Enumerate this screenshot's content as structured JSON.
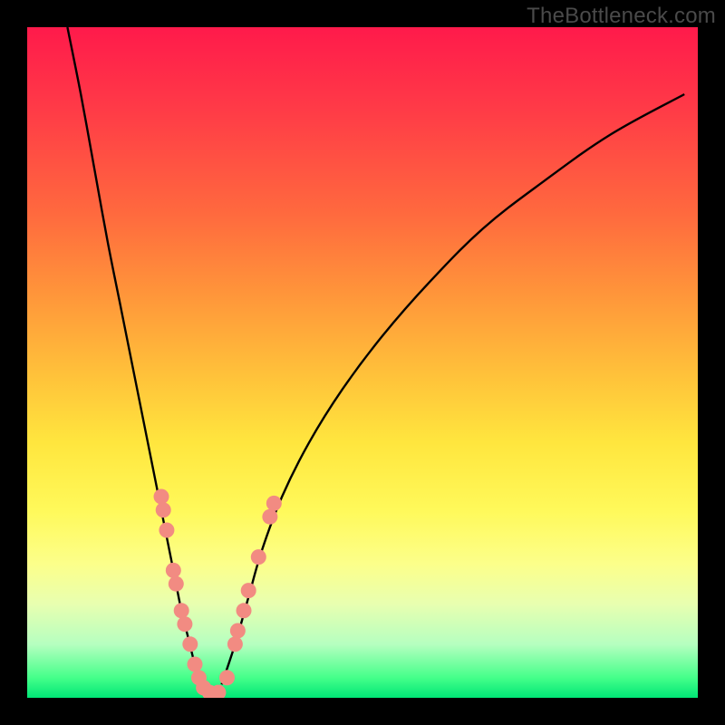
{
  "watermark": "TheBottleneck.com",
  "palette": {
    "curve_stroke": "#000000",
    "marker_fill": "#f28b82",
    "marker_stroke": "#e06a60",
    "frame": "#000000"
  },
  "chart_data": {
    "type": "line",
    "title": "",
    "xlabel": "",
    "ylabel": "",
    "xlim": [
      0,
      100
    ],
    "ylim": [
      0,
      100
    ],
    "grid": false,
    "legend": false,
    "note": "Curve is a V-shaped bottleneck chart. Y encodes severity (0 at baseline/bottom = no bottleneck, 100 at top = extreme). Values estimated from pixel position against the rainbow gradient backdrop; 0–2 falls in the green band, ~60+ in the red band.",
    "series": [
      {
        "name": "left-branch",
        "x": [
          6,
          8,
          10,
          12,
          14,
          16,
          18,
          19,
          20,
          21,
          22,
          23,
          24,
          25,
          26
        ],
        "values": [
          100,
          90,
          79,
          68,
          58,
          48,
          38,
          33,
          28,
          23,
          18,
          13,
          9,
          5,
          2
        ]
      },
      {
        "name": "bottom",
        "x": [
          26,
          27,
          28,
          29
        ],
        "values": [
          1,
          0.5,
          0.5,
          1
        ]
      },
      {
        "name": "right-branch",
        "x": [
          29,
          31,
          33,
          35,
          38,
          42,
          47,
          53,
          60,
          68,
          77,
          87,
          98
        ],
        "values": [
          2,
          8,
          15,
          22,
          30,
          38,
          46,
          54,
          62,
          70,
          77,
          84,
          90
        ]
      }
    ],
    "markers": {
      "name": "highlighted-points",
      "fill": "#f28b82",
      "points": [
        {
          "x": 20.0,
          "y": 30
        },
        {
          "x": 20.3,
          "y": 28
        },
        {
          "x": 20.8,
          "y": 25
        },
        {
          "x": 21.8,
          "y": 19
        },
        {
          "x": 22.2,
          "y": 17
        },
        {
          "x": 23.0,
          "y": 13
        },
        {
          "x": 23.5,
          "y": 11
        },
        {
          "x": 24.3,
          "y": 8
        },
        {
          "x": 25.0,
          "y": 5
        },
        {
          "x": 25.6,
          "y": 3
        },
        {
          "x": 26.3,
          "y": 1.5
        },
        {
          "x": 27.2,
          "y": 0.8
        },
        {
          "x": 28.5,
          "y": 0.8
        },
        {
          "x": 29.8,
          "y": 3
        },
        {
          "x": 31.0,
          "y": 8
        },
        {
          "x": 31.4,
          "y": 10
        },
        {
          "x": 32.3,
          "y": 13
        },
        {
          "x": 33.0,
          "y": 16
        },
        {
          "x": 34.5,
          "y": 21
        },
        {
          "x": 36.2,
          "y": 27
        },
        {
          "x": 36.8,
          "y": 29
        }
      ]
    }
  }
}
